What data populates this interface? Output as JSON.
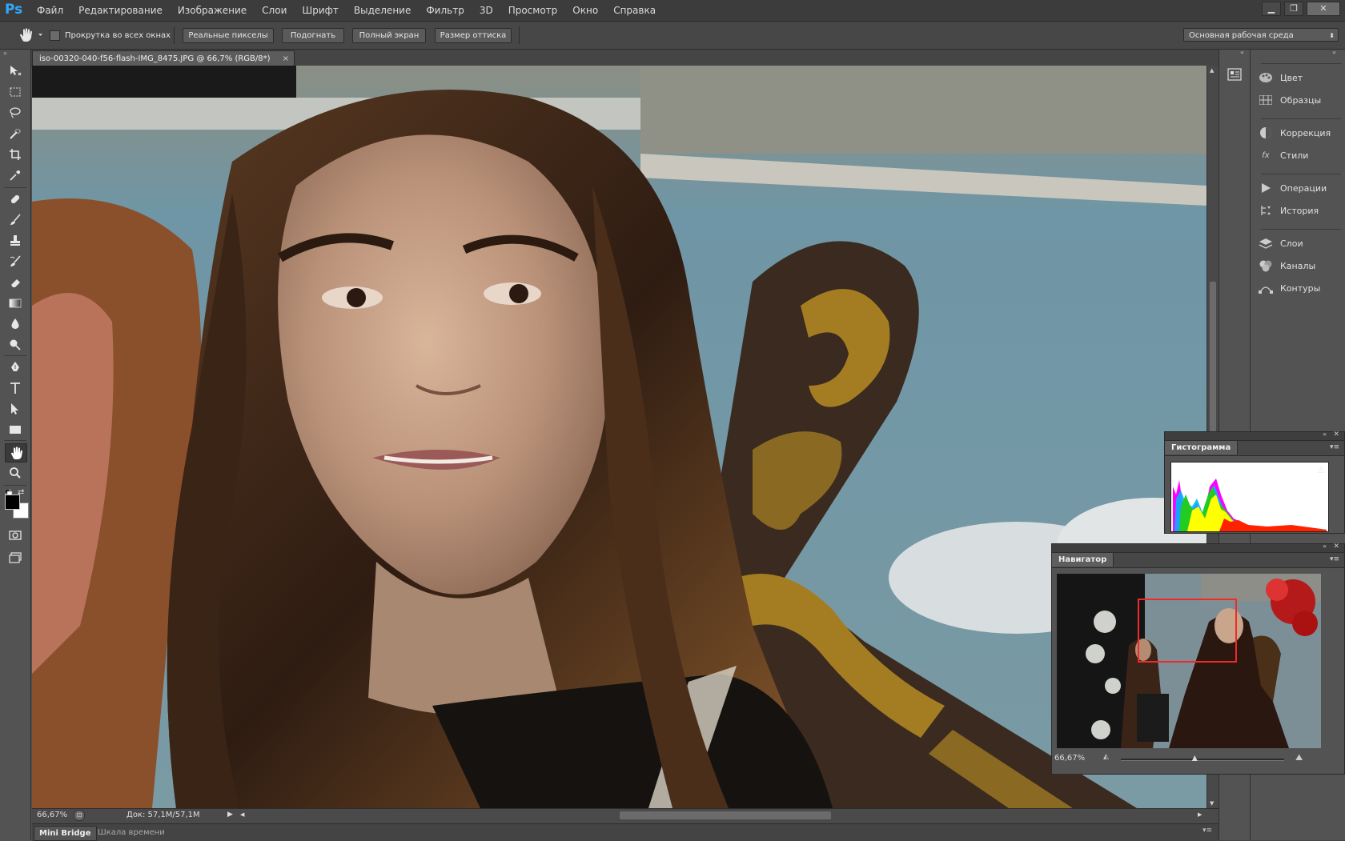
{
  "app": {
    "logo": "Ps"
  },
  "menu": [
    "Файл",
    "Редактирование",
    "Изображение",
    "Слои",
    "Шрифт",
    "Выделение",
    "Фильтр",
    "3D",
    "Просмотр",
    "Окно",
    "Справка"
  ],
  "options": {
    "scroll_all_windows": "Прокрутка во всех окнах",
    "actual_pixels": "Реальные пикселы",
    "fit": "Подогнать",
    "fullscreen": "Полный экран",
    "print_size": "Размер оттиска",
    "workspace": "Основная рабочая среда"
  },
  "document": {
    "tab_title": "iso-00320-040-f56-flash-IMG_8475.JPG @ 66,7% (RGB/8*)",
    "zoom": "66,67%",
    "doc_size": "Док: 57,1M/57,1M"
  },
  "bottom_tabs": [
    "Mini Bridge",
    "Шкала времени"
  ],
  "dock": [
    {
      "label": "Цвет",
      "icon": "color-palette-icon"
    },
    {
      "label": "Образцы",
      "icon": "swatches-grid-icon"
    },
    {
      "label": "Коррекция",
      "icon": "adjustments-icon"
    },
    {
      "label": "Стили",
      "icon": "styles-fx-icon"
    },
    {
      "label": "Операции",
      "icon": "actions-play-icon"
    },
    {
      "label": "История",
      "icon": "history-icon"
    },
    {
      "label": "Слои",
      "icon": "layers-icon"
    },
    {
      "label": "Каналы",
      "icon": "channels-icon"
    },
    {
      "label": "Контуры",
      "icon": "paths-icon"
    }
  ],
  "histogram": {
    "title": "Гистограмма"
  },
  "navigator": {
    "title": "Навигатор",
    "zoom": "66,67%",
    "zoom_level": 0.45
  },
  "colors": {
    "accent": "#31a8ff",
    "foreground": "#000000",
    "background": "#ffffff"
  }
}
